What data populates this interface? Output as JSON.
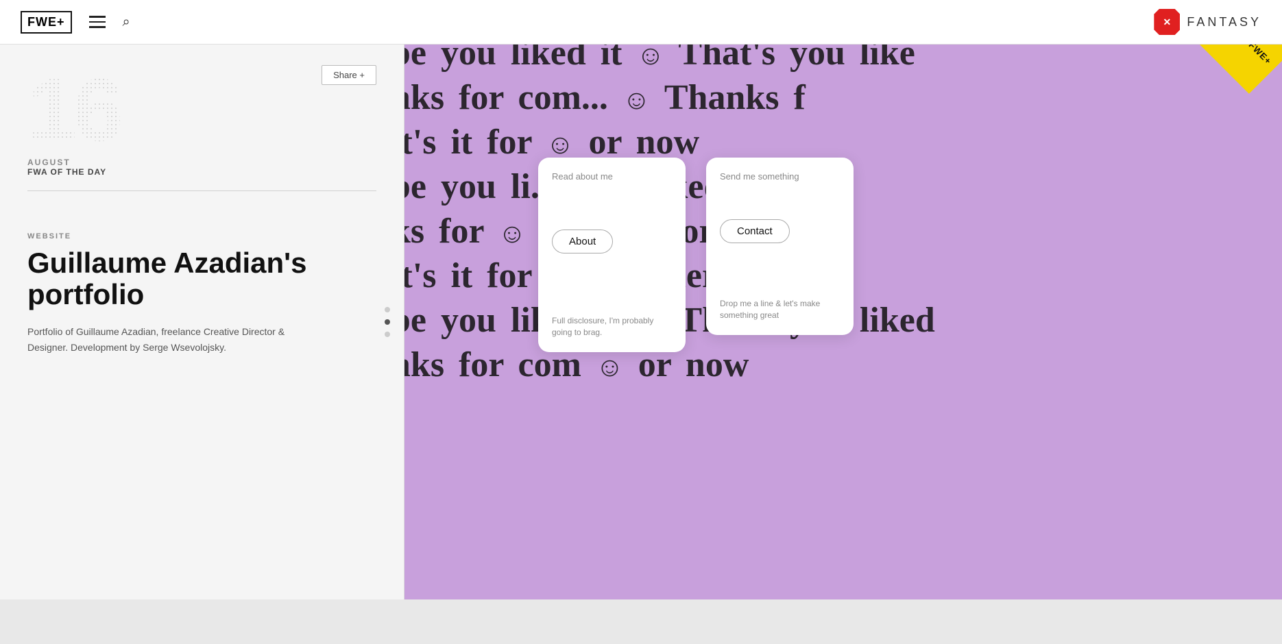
{
  "header": {
    "logo_text": "FWE+",
    "search_placeholder": "Search...",
    "fantasy_label": "FANTASY"
  },
  "left_panel": {
    "date_number": "16",
    "date_month": "AUGUST",
    "fwa_label": "FWA OF THE DAY",
    "share_button": "Share +",
    "website_label": "WEBSITE",
    "site_title": "Guillaume Azadian's portfolio",
    "site_description": "Portfolio of Guillaume Azadian, freelance Creative Director & Designer. Development by Serge Wsevolojsky."
  },
  "dots": [
    {
      "active": false
    },
    {
      "active": true
    },
    {
      "active": false
    }
  ],
  "screenshot": {
    "bg_color": "#c8a0dc",
    "bg_rows": [
      "be you liked it 😊 That's you like",
      "nks for com... 😊 Thanks f",
      "it's it for 😊 or now",
      "be you li... 😊 u liked",
      "ks for 😊 Thanks f",
      "it's it for now 😊 here it for",
      "be you liked it 😊 That's you liked",
      "nks for com 😊 or now"
    ],
    "card_about": {
      "label": "Read about me",
      "button": "About",
      "sub_text": "Full disclosure, I'm probably going to brag."
    },
    "card_contact": {
      "label": "Send me something",
      "button": "Contact",
      "sub_text": "Drop me a line & let's make something great"
    },
    "fwe_badge_text": "FWE+"
  }
}
